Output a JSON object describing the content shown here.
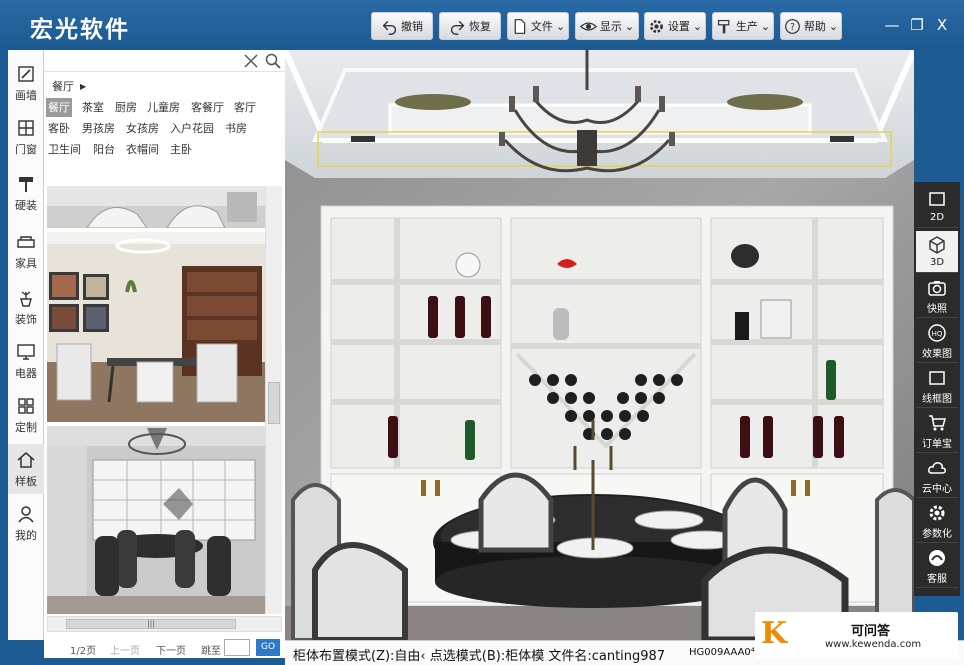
{
  "app": {
    "title": "宏光软件"
  },
  "toolbar": {
    "undo": "撤销",
    "redo": "恢复",
    "file": "文件",
    "display": "显示",
    "settings": "设置",
    "produce": "生产",
    "help": "帮助"
  },
  "window": {
    "minimize": "—",
    "restore": "❐",
    "close": "X"
  },
  "leftbar": {
    "items": [
      {
        "label": "画墙",
        "icon": "pen-icon"
      },
      {
        "label": "门窗",
        "icon": "window-icon"
      },
      {
        "label": "硬装",
        "icon": "paint-roller-icon"
      },
      {
        "label": "家具",
        "icon": "sofa-icon"
      },
      {
        "label": "装饰",
        "icon": "plant-icon"
      },
      {
        "label": "电器",
        "icon": "monitor-icon"
      },
      {
        "label": "定制",
        "icon": "grid-icon"
      },
      {
        "label": "样板",
        "icon": "house-icon"
      },
      {
        "label": "我的",
        "icon": "user-icon"
      }
    ],
    "selected": "样板"
  },
  "panel": {
    "breadcrumb": "餐厅",
    "categories": [
      "餐厅",
      "茶室",
      "厨房",
      "儿童房",
      "客餐厅",
      "客厅",
      "客卧",
      "男孩房",
      "女孩房",
      "入户花园",
      "书房",
      "卫生间",
      "阳台",
      "衣帽间",
      "主卧"
    ],
    "selected_category": "餐厅",
    "pager": {
      "page": "1/2页",
      "prev": "上一页",
      "next": "下一页",
      "jump": "跳至",
      "go": "GO"
    }
  },
  "rightbar": {
    "items": [
      {
        "label": "2D",
        "icon": "square-2d-icon"
      },
      {
        "label": "3D",
        "icon": "cube-3d-icon"
      },
      {
        "label": "快照",
        "icon": "camera-icon"
      },
      {
        "label": "效果图",
        "icon": "hd-render-icon"
      },
      {
        "label": "线框图",
        "icon": "wireframe-icon"
      },
      {
        "label": "订单宝",
        "icon": "cart-icon"
      },
      {
        "label": "云中心",
        "icon": "cloud-icon"
      },
      {
        "label": "参数化",
        "icon": "gear-icon"
      },
      {
        "label": "客服",
        "icon": "headset-icon"
      }
    ],
    "selected": "3D"
  },
  "status": {
    "text": "柜体布置模式(Z):自由‹ 点选模式(B):柜体模 文件名:canting987",
    "code": "HG009AAA0⁴"
  },
  "watermark": {
    "logo": "K",
    "title": "可问答",
    "url": "www.kewenda.com"
  }
}
